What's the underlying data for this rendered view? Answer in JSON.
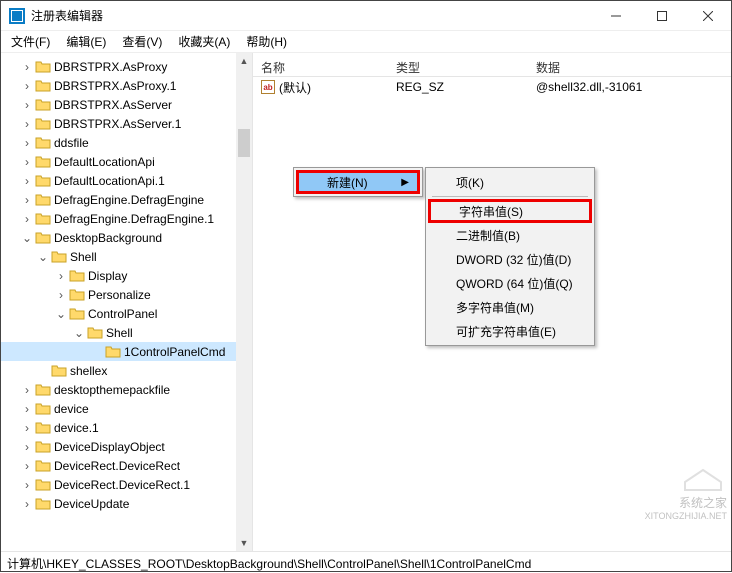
{
  "title": "注册表编辑器",
  "menus": {
    "file": "文件(F)",
    "edit": "编辑(E)",
    "view": "查看(V)",
    "fav": "收藏夹(A)",
    "help": "帮助(H)"
  },
  "cols": {
    "name": "名称",
    "type": "类型",
    "data": "数据"
  },
  "row": {
    "name": "(默认)",
    "type": "REG_SZ",
    "data": "@shell32.dll,-31061"
  },
  "ctx": {
    "new": "新建(N)"
  },
  "sub": {
    "key": "项(K)",
    "string": "字符串值(S)",
    "binary": "二进制值(B)",
    "dword": "DWORD (32 位)值(D)",
    "qword": "QWORD (64 位)值(Q)",
    "multi": "多字符串值(M)",
    "expand": "可扩充字符串值(E)"
  },
  "status": "计算机\\HKEY_CLASSES_ROOT\\DesktopBackground\\Shell\\ControlPanel\\Shell\\1ControlPanelCmd",
  "tree": [
    {
      "ind": 1,
      "caret": ">",
      "label": "DBRSTPRX.AsProxy"
    },
    {
      "ind": 1,
      "caret": ">",
      "label": "DBRSTPRX.AsProxy.1"
    },
    {
      "ind": 1,
      "caret": ">",
      "label": "DBRSTPRX.AsServer"
    },
    {
      "ind": 1,
      "caret": ">",
      "label": "DBRSTPRX.AsServer.1"
    },
    {
      "ind": 1,
      "caret": ">",
      "label": "ddsfile"
    },
    {
      "ind": 1,
      "caret": ">",
      "label": "DefaultLocationApi"
    },
    {
      "ind": 1,
      "caret": ">",
      "label": "DefaultLocationApi.1"
    },
    {
      "ind": 1,
      "caret": ">",
      "label": "DefragEngine.DefragEngine"
    },
    {
      "ind": 1,
      "caret": ">",
      "label": "DefragEngine.DefragEngine.1"
    },
    {
      "ind": 1,
      "caret": "v",
      "label": "DesktopBackground"
    },
    {
      "ind": 2,
      "caret": "v",
      "label": "Shell"
    },
    {
      "ind": 3,
      "caret": ">",
      "label": "Display"
    },
    {
      "ind": 3,
      "caret": ">",
      "label": "Personalize"
    },
    {
      "ind": 3,
      "caret": "v",
      "label": "ControlPanel"
    },
    {
      "ind": 4,
      "caret": "v",
      "label": "Shell"
    },
    {
      "ind": 5,
      "caret": "",
      "label": "1ControlPanelCmd",
      "sel": true
    },
    {
      "ind": 2,
      "caret": "",
      "label": "shellex"
    },
    {
      "ind": 1,
      "caret": ">",
      "label": "desktopthemepackfile"
    },
    {
      "ind": 1,
      "caret": ">",
      "label": "device"
    },
    {
      "ind": 1,
      "caret": ">",
      "label": "device.1"
    },
    {
      "ind": 1,
      "caret": ">",
      "label": "DeviceDisplayObject"
    },
    {
      "ind": 1,
      "caret": ">",
      "label": "DeviceRect.DeviceRect"
    },
    {
      "ind": 1,
      "caret": ">",
      "label": "DeviceRect.DeviceRect.1"
    },
    {
      "ind": 1,
      "caret": ">",
      "label": "DeviceUpdate"
    }
  ],
  "watermark": {
    "line1": "系统之家",
    "line2": "XITONGZHIJIA.NET"
  }
}
